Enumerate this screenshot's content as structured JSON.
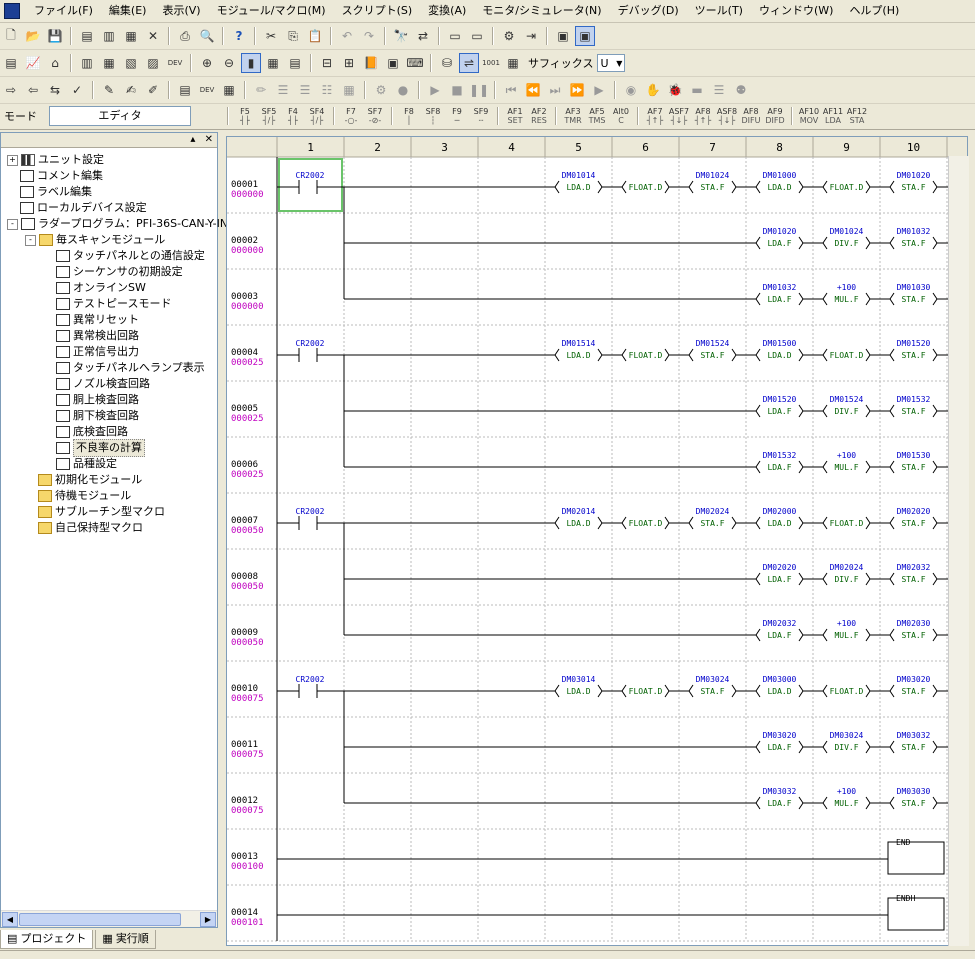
{
  "menu": [
    "ファイル(F)",
    "編集(E)",
    "表示(V)",
    "モジュール/マクロ(M)",
    "スクリプト(S)",
    "変換(A)",
    "モニタ/シミュレータ(N)",
    "デバッグ(D)",
    "ツール(T)",
    "ウィンドウ(W)",
    "ヘルプ(H)"
  ],
  "toolbar": {
    "suffix_label": "サフィックス",
    "suffix_value": "U",
    "mode_label": "モード",
    "mode_value": "エディタ"
  },
  "fkeys": [
    {
      "k": "F5",
      "s": "┤├"
    },
    {
      "k": "SF5",
      "s": "┤/├"
    },
    {
      "k": "F4",
      "s": "┤├"
    },
    {
      "k": "SF4",
      "s": "┤/├"
    },
    {
      "k": "F7",
      "s": "-○-"
    },
    {
      "k": "SF7",
      "s": "-⊘-"
    },
    {
      "k": "F8",
      "s": "│"
    },
    {
      "k": "SF8",
      "s": "┆"
    },
    {
      "k": "F9",
      "s": "─"
    },
    {
      "k": "SF9",
      "s": "┄"
    },
    {
      "k": "AF1",
      "s": "SET"
    },
    {
      "k": "AF2",
      "s": "RES"
    },
    {
      "k": "AF3",
      "s": "TMR"
    },
    {
      "k": "AF5",
      "s": "TMS"
    },
    {
      "k": "Alt0",
      "s": "C"
    },
    {
      "k": "AF7",
      "s": "┤↑├"
    },
    {
      "k": "ASF7",
      "s": "┤↓├"
    },
    {
      "k": "AF8",
      "s": "┤↑├"
    },
    {
      "k": "ASF8",
      "s": "┤↓├"
    },
    {
      "k": "AF8",
      "s": "DIFU"
    },
    {
      "k": "AF9",
      "s": "DIFD"
    },
    {
      "k": "AF10",
      "s": "MOV"
    },
    {
      "k": "AF11",
      "s": "LDA"
    },
    {
      "k": "AF12",
      "s": "STA"
    }
  ],
  "tree": [
    {
      "label": "ユニット設定",
      "level": 0,
      "icon": "unit",
      "exp": "+"
    },
    {
      "label": "コメント編集",
      "level": 0,
      "icon": "doc",
      "exp": ""
    },
    {
      "label": "ラベル編集",
      "level": 0,
      "icon": "doc",
      "exp": ""
    },
    {
      "label": "ローカルデバイス設定",
      "level": 0,
      "icon": "doc",
      "exp": ""
    },
    {
      "label": "ラダープログラム：PFI-36S-CAN-Y-IN",
      "level": 0,
      "icon": "doc",
      "exp": "-"
    },
    {
      "label": "毎スキャンモジュール",
      "level": 1,
      "icon": "folder",
      "exp": "-"
    },
    {
      "label": "タッチパネルとの通信設定",
      "level": 2,
      "icon": "doc",
      "exp": ""
    },
    {
      "label": "シーケンサの初期設定",
      "level": 2,
      "icon": "doc",
      "exp": ""
    },
    {
      "label": "オンラインSW",
      "level": 2,
      "icon": "doc",
      "exp": ""
    },
    {
      "label": "テストピースモード",
      "level": 2,
      "icon": "doc",
      "exp": ""
    },
    {
      "label": "異常リセット",
      "level": 2,
      "icon": "doc",
      "exp": ""
    },
    {
      "label": "異常検出回路",
      "level": 2,
      "icon": "doc",
      "exp": ""
    },
    {
      "label": "正常信号出力",
      "level": 2,
      "icon": "doc",
      "exp": ""
    },
    {
      "label": "タッチパネルへランプ表示",
      "level": 2,
      "icon": "doc",
      "exp": ""
    },
    {
      "label": "ノズル検査回路",
      "level": 2,
      "icon": "doc",
      "exp": ""
    },
    {
      "label": "胴上検査回路",
      "level": 2,
      "icon": "doc",
      "exp": ""
    },
    {
      "label": "胴下検査回路",
      "level": 2,
      "icon": "doc",
      "exp": ""
    },
    {
      "label": "底検査回路",
      "level": 2,
      "icon": "doc",
      "exp": ""
    },
    {
      "label": "不良率の計算",
      "level": 2,
      "icon": "doc",
      "exp": "",
      "selected": true
    },
    {
      "label": "品種設定",
      "level": 2,
      "icon": "doc",
      "exp": ""
    },
    {
      "label": "初期化モジュール",
      "level": 1,
      "icon": "folder",
      "exp": ""
    },
    {
      "label": "待機モジュール",
      "level": 1,
      "icon": "folder",
      "exp": ""
    },
    {
      "label": "サブルーチン型マクロ",
      "level": 1,
      "icon": "folder",
      "exp": ""
    },
    {
      "label": "自己保持型マクロ",
      "level": 1,
      "icon": "folder",
      "exp": ""
    }
  ],
  "tabs": [
    "プロジェクト",
    "実行順"
  ],
  "columns": [
    "1",
    "2",
    "3",
    "4",
    "5",
    "6",
    "7",
    "8",
    "9",
    "10"
  ],
  "rungs": [
    {
      "num": "00001",
      "addr": "000000",
      "contact": "CR2002",
      "ops": [
        {
          "c": 5,
          "dev": "DM01014",
          "ins": "LDA.D"
        },
        {
          "c": 6,
          "dev": "",
          "ins": "FLOAT.D"
        },
        {
          "c": 7,
          "dev": "DM01024",
          "ins": "STA.F"
        },
        {
          "c": 8,
          "dev": "DM01000",
          "ins": "LDA.D"
        },
        {
          "c": 9,
          "dev": "",
          "ins": "FLOAT.D"
        },
        {
          "c": 10,
          "dev": "DM01020",
          "ins": "STA.F"
        }
      ]
    },
    {
      "num": "00002",
      "addr": "000000",
      "contact": "",
      "ops": [
        {
          "c": 8,
          "dev": "DM01020",
          "ins": "LDA.F"
        },
        {
          "c": 9,
          "dev": "DM01024",
          "ins": "DIV.F"
        },
        {
          "c": 10,
          "dev": "DM01032",
          "ins": "STA.F"
        }
      ]
    },
    {
      "num": "00003",
      "addr": "000000",
      "contact": "",
      "ops": [
        {
          "c": 8,
          "dev": "DM01032",
          "ins": "LDA.F"
        },
        {
          "c": 9,
          "dev": "+100",
          "ins": "MUL.F"
        },
        {
          "c": 10,
          "dev": "DM01030",
          "ins": "STA.F"
        }
      ]
    },
    {
      "num": "00004",
      "addr": "000025",
      "contact": "CR2002",
      "ops": [
        {
          "c": 5,
          "dev": "DM01514",
          "ins": "LDA.D"
        },
        {
          "c": 6,
          "dev": "",
          "ins": "FLOAT.D"
        },
        {
          "c": 7,
          "dev": "DM01524",
          "ins": "STA.F"
        },
        {
          "c": 8,
          "dev": "DM01500",
          "ins": "LDA.D"
        },
        {
          "c": 9,
          "dev": "",
          "ins": "FLOAT.D"
        },
        {
          "c": 10,
          "dev": "DM01520",
          "ins": "STA.F"
        }
      ]
    },
    {
      "num": "00005",
      "addr": "000025",
      "contact": "",
      "ops": [
        {
          "c": 8,
          "dev": "DM01520",
          "ins": "LDA.F"
        },
        {
          "c": 9,
          "dev": "DM01524",
          "ins": "DIV.F"
        },
        {
          "c": 10,
          "dev": "DM01532",
          "ins": "STA.F"
        }
      ]
    },
    {
      "num": "00006",
      "addr": "000025",
      "contact": "",
      "ops": [
        {
          "c": 8,
          "dev": "DM01532",
          "ins": "LDA.F"
        },
        {
          "c": 9,
          "dev": "+100",
          "ins": "MUL.F"
        },
        {
          "c": 10,
          "dev": "DM01530",
          "ins": "STA.F"
        }
      ]
    },
    {
      "num": "00007",
      "addr": "000050",
      "contact": "CR2002",
      "ops": [
        {
          "c": 5,
          "dev": "DM02014",
          "ins": "LDA.D"
        },
        {
          "c": 6,
          "dev": "",
          "ins": "FLOAT.D"
        },
        {
          "c": 7,
          "dev": "DM02024",
          "ins": "STA.F"
        },
        {
          "c": 8,
          "dev": "DM02000",
          "ins": "LDA.D"
        },
        {
          "c": 9,
          "dev": "",
          "ins": "FLOAT.D"
        },
        {
          "c": 10,
          "dev": "DM02020",
          "ins": "STA.F"
        }
      ]
    },
    {
      "num": "00008",
      "addr": "000050",
      "contact": "",
      "ops": [
        {
          "c": 8,
          "dev": "DM02020",
          "ins": "LDA.F"
        },
        {
          "c": 9,
          "dev": "DM02024",
          "ins": "DIV.F"
        },
        {
          "c": 10,
          "dev": "DM02032",
          "ins": "STA.F"
        }
      ]
    },
    {
      "num": "00009",
      "addr": "000050",
      "contact": "",
      "ops": [
        {
          "c": 8,
          "dev": "DM02032",
          "ins": "LDA.F"
        },
        {
          "c": 9,
          "dev": "+100",
          "ins": "MUL.F"
        },
        {
          "c": 10,
          "dev": "DM02030",
          "ins": "STA.F"
        }
      ]
    },
    {
      "num": "00010",
      "addr": "000075",
      "contact": "CR2002",
      "ops": [
        {
          "c": 5,
          "dev": "DM03014",
          "ins": "LDA.D"
        },
        {
          "c": 6,
          "dev": "",
          "ins": "FLOAT.D"
        },
        {
          "c": 7,
          "dev": "DM03024",
          "ins": "STA.F"
        },
        {
          "c": 8,
          "dev": "DM03000",
          "ins": "LDA.D"
        },
        {
          "c": 9,
          "dev": "",
          "ins": "FLOAT.D"
        },
        {
          "c": 10,
          "dev": "DM03020",
          "ins": "STA.F"
        }
      ]
    },
    {
      "num": "00011",
      "addr": "000075",
      "contact": "",
      "ops": [
        {
          "c": 8,
          "dev": "DM03020",
          "ins": "LDA.F"
        },
        {
          "c": 9,
          "dev": "DM03024",
          "ins": "DIV.F"
        },
        {
          "c": 10,
          "dev": "DM03032",
          "ins": "STA.F"
        }
      ]
    },
    {
      "num": "00012",
      "addr": "000075",
      "contact": "",
      "ops": [
        {
          "c": 8,
          "dev": "DM03032",
          "ins": "LDA.F"
        },
        {
          "c": 9,
          "dev": "+100",
          "ins": "MUL.F"
        },
        {
          "c": 10,
          "dev": "DM03030",
          "ins": "STA.F"
        }
      ]
    },
    {
      "num": "00013",
      "addr": "000100",
      "contact": "",
      "end": "END",
      "ops": []
    },
    {
      "num": "00014",
      "addr": "000101",
      "contact": "",
      "end": "ENDH",
      "ops": []
    }
  ]
}
